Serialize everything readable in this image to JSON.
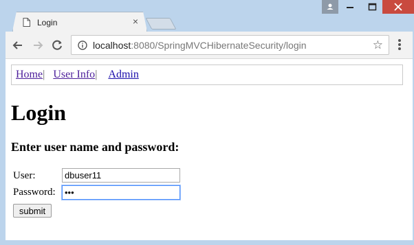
{
  "tab": {
    "title": "Login",
    "close_glyph": "×"
  },
  "address_bar": {
    "host": "localhost",
    "path": ":8080/SpringMVCHibernateSecurity/login"
  },
  "nav": {
    "home": "Home",
    "sep1": "|",
    "user_info": "User Info",
    "sep2": "|",
    "admin": "Admin"
  },
  "page": {
    "title": "Login",
    "subtitle": "Enter user name and password:"
  },
  "form": {
    "user_label": "User:",
    "user_value": "dbuser11",
    "password_label": "Password:",
    "password_value": "•••",
    "submit_label": "submit"
  },
  "colors": {
    "link": "#4b1d9a",
    "link_unvisited": "#1a0dab",
    "close_button": "#c94a3f",
    "frame": "#bcd4ec"
  },
  "icons": [
    "page-icon",
    "close-icon",
    "user-icon",
    "minimize-icon",
    "maximize-icon",
    "window-close-icon",
    "back-arrow-icon",
    "forward-arrow-icon",
    "reload-icon",
    "info-icon",
    "star-icon",
    "menu-icon"
  ]
}
